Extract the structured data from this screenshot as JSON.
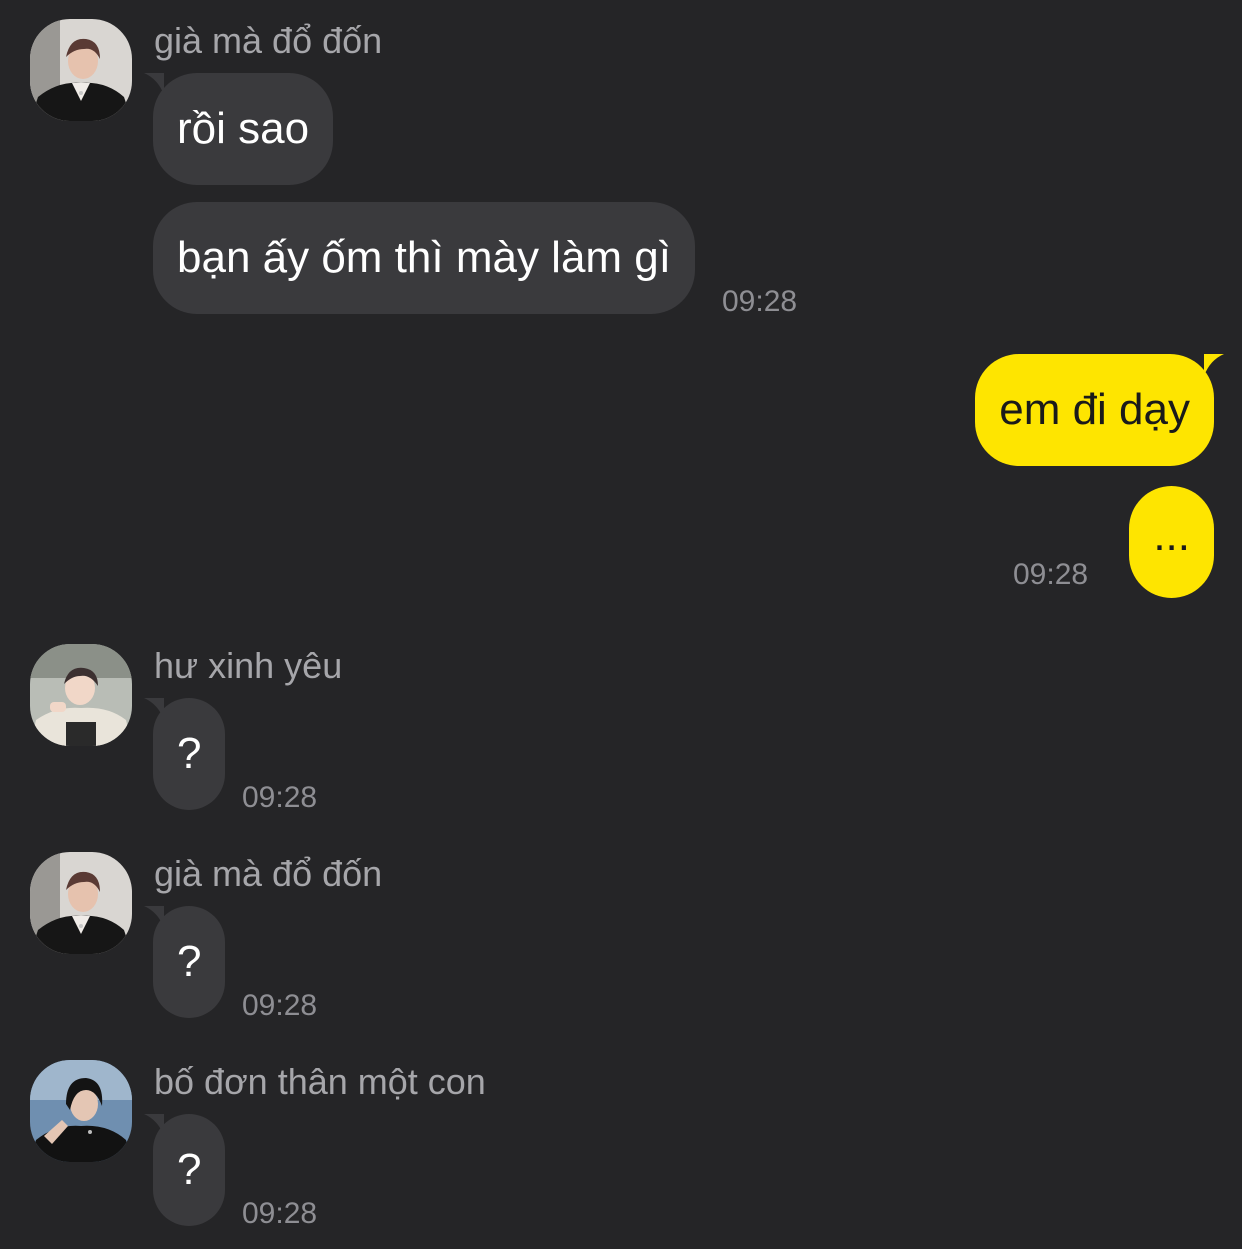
{
  "messages": [
    {
      "sender": "già mà đổ đốn",
      "avatar": "avatar-1",
      "texts": [
        "rồi sao",
        "bạn ấy ốm thì mày làm gì"
      ],
      "time": "09:28"
    },
    {
      "sender": "me",
      "texts": [
        "em đi dạy",
        "..."
      ],
      "time": "09:28"
    },
    {
      "sender": "hư xinh yêu",
      "avatar": "avatar-2",
      "texts": [
        "?"
      ],
      "time": "09:28"
    },
    {
      "sender": "già mà đổ đốn",
      "avatar": "avatar-1",
      "texts": [
        "?"
      ],
      "time": "09:28"
    },
    {
      "sender": "bố đơn thân một con",
      "avatar": "avatar-3",
      "texts": [
        "?"
      ],
      "time": "09:28"
    }
  ],
  "colors": {
    "background": "#252527",
    "incoming_bubble": "#3a3a3d",
    "outgoing_bubble": "#fee500",
    "name_text": "#a6a6aa",
    "time_text": "#8e8e93"
  }
}
